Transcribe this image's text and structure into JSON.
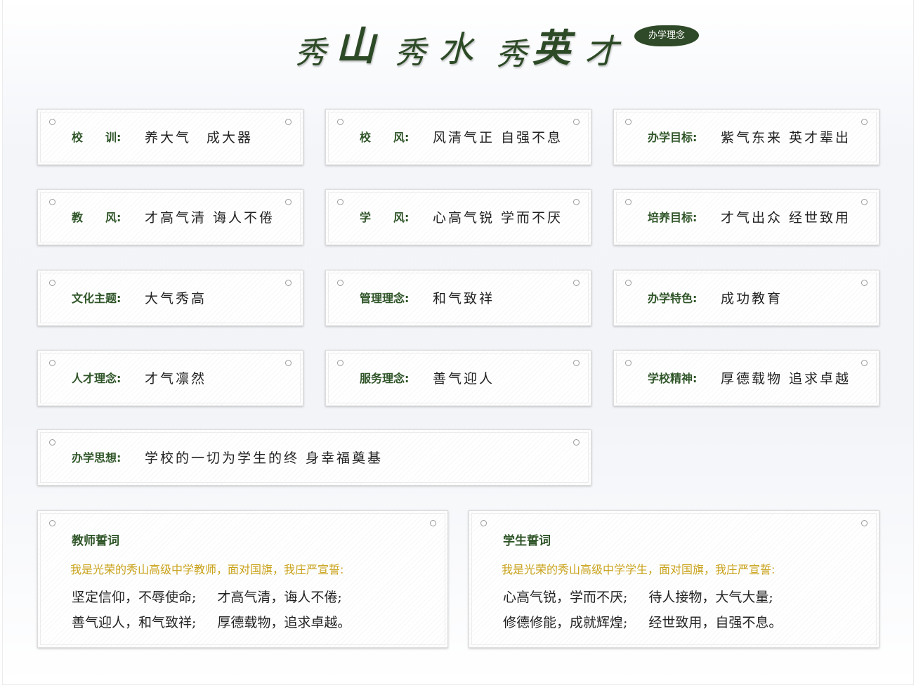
{
  "header": {
    "title_chars": [
      "秀",
      "山",
      "秀",
      "水",
      "秀",
      "英",
      "才"
    ],
    "badge": "办学理念",
    "brand_color": "#2f4a28",
    "label_color": "#2f5528",
    "accent_color": "#c9a21a"
  },
  "items": [
    {
      "label": "校　　训:",
      "value": "养大气　成大器"
    },
    {
      "label": "校　　风:",
      "value": "风清气正 自强不息"
    },
    {
      "label": "办学目标:",
      "value": "紫气东来 英才辈出"
    },
    {
      "label": "教　　风:",
      "value": "才高气清 诲人不倦"
    },
    {
      "label": "学　　风:",
      "value": "心高气锐 学而不厌"
    },
    {
      "label": "培养目标:",
      "value": "才气出众 经世致用"
    },
    {
      "label": "文化主题:",
      "value": "大气秀高"
    },
    {
      "label": "管理理念:",
      "value": "和气致祥"
    },
    {
      "label": "办学特色:",
      "value": "成功教育"
    },
    {
      "label": "人才理念:",
      "value": "才气凛然"
    },
    {
      "label": "服务理念:",
      "value": "善气迎人"
    },
    {
      "label": "学校精神:",
      "value": "厚德载物 追求卓越"
    },
    {
      "label": "办学思想:",
      "value": "学校的一切为学生的终 身幸福奠基"
    }
  ],
  "pledges": {
    "teacher": {
      "title": "教师誓词",
      "intro": "我是光荣的秀山高级中学教师，面对国旗，我庄严宣誓:",
      "lines": [
        [
          "坚定信仰，不辱使命;",
          "才高气清，诲人不倦;"
        ],
        [
          "善气迎人，和气致祥;",
          "厚德载物，追求卓越。"
        ]
      ]
    },
    "student": {
      "title": "学生誓词",
      "intro": "我是光荣的秀山高级中学学生，面对国旗，我庄严宣誓:",
      "lines": [
        [
          "心高气锐，学而不厌;",
          "待人接物，大气大量;"
        ],
        [
          "修德修能，成就辉煌;",
          "经世致用，自强不息。"
        ]
      ]
    }
  }
}
